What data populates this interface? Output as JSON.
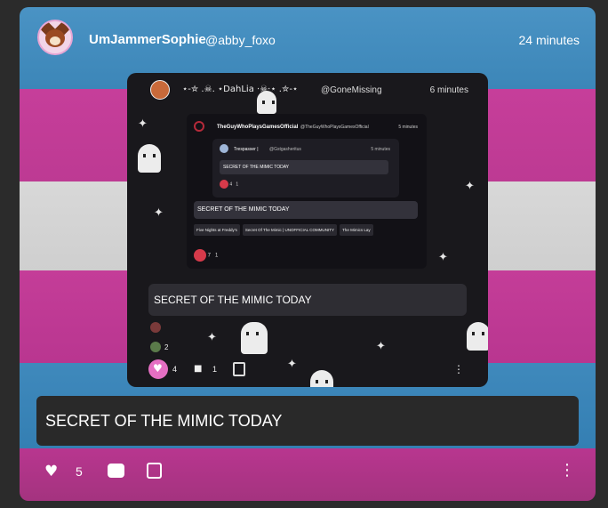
{
  "post": {
    "username": "UmJammerSophie",
    "handle": "@abby_foxo",
    "time": "24 minutes",
    "caption": "SECRET OF THE MIMIC TODAY",
    "likes": "5"
  },
  "embed": {
    "name": "⋆-✮ .☠. ⋆DahLia ⋅☠⋅⋆ .✮-⋆",
    "handle": "@GoneMissing",
    "time": "6 minutes",
    "text": "SECRET OF THE MIMIC TODAY",
    "likes": "4",
    "comments": "1",
    "small_count": "2",
    "inner": {
      "name": "TheGuyWhoPlaysGamesOfficial",
      "handle": "@TheGuyWhoPlaysGamesOfficial",
      "time": "5 minutes",
      "text": "SECRET OF THE MIMIC TODAY",
      "likes": "7",
      "comments": "1",
      "tags": [
        "Five Nights at Freddy's",
        "Secret Of The Mimic | UNOFFICIAL COMMUNITY",
        "The Mimics Lay"
      ],
      "nested": {
        "name": "Trespasser |",
        "handle": "@Gstgasheritus",
        "time": "5 minutes",
        "text": "SECRET OF THE MIMIC TODAY",
        "likes": "4",
        "comments": "1"
      }
    }
  },
  "icons": {
    "heart": "♥",
    "comment": "comment-bubble",
    "reblog": "reblog",
    "more": "⋮",
    "star": "✦"
  },
  "colors": {
    "card_bg": "#292929",
    "like_pink": "#e56fc3",
    "trans_blue": "#4a93c4",
    "trans_pink": "#c63e9a",
    "trans_white": "#d8d8d8"
  }
}
